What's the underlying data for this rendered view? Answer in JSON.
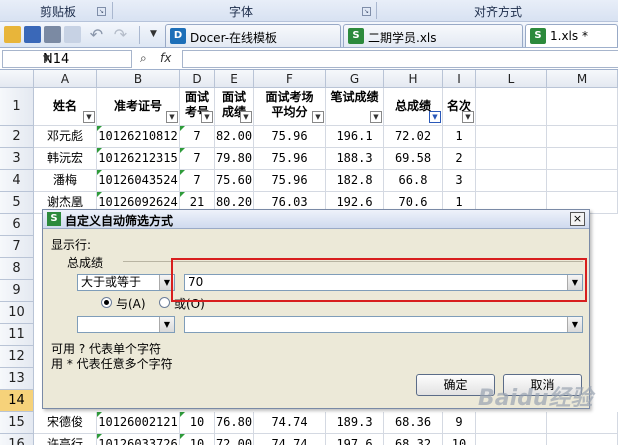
{
  "ribbon": {
    "groups": [
      "剪贴板",
      "字体",
      "对齐方式"
    ]
  },
  "tabs": [
    {
      "label": "Docer-在线模板",
      "icon": "D",
      "color": "#1d6fb8",
      "active": false
    },
    {
      "label": "二期学员.xls",
      "icon": "S",
      "color": "#2c8a3c",
      "active": false
    },
    {
      "label": "1.xls *",
      "icon": "S",
      "color": "#2c8a3c",
      "active": true
    }
  ],
  "formula_bar": {
    "name_box": "N14",
    "fx_symbol": "fx",
    "value": ""
  },
  "columns": [
    "A",
    "B",
    "D",
    "E",
    "F",
    "G",
    "H",
    "I",
    "L",
    "M"
  ],
  "row_numbers": [
    "1",
    "2",
    "3",
    "4",
    "5",
    "6",
    "7",
    "8",
    "9",
    "10",
    "11",
    "12",
    "13",
    "14",
    "15",
    "16"
  ],
  "selected_row": "14",
  "headers": [
    "姓名",
    "准考证号",
    "面试考号",
    "面试成绩",
    "面试考场平均分",
    "笔试成绩",
    "总成绩",
    "名次"
  ],
  "rows": [
    [
      "邓元彪",
      "10126210812",
      "7",
      "82.00",
      "75.96",
      "196.1",
      "72.02",
      "1"
    ],
    [
      "韩沅宏",
      "10126212315",
      "7",
      "79.80",
      "75.96",
      "188.3",
      "69.58",
      "2"
    ],
    [
      "潘梅",
      "10126043524",
      "7",
      "75.60",
      "75.96",
      "182.8",
      "66.8",
      "3"
    ],
    [
      "谢杰凰",
      "10126092624",
      "21",
      "80.20",
      "76.03",
      "192.6",
      "70.6",
      "1"
    ]
  ],
  "partial_rows": [
    [
      "宋德俊",
      "10126002121",
      "10",
      "76.80",
      "74.74",
      "189.3",
      "68.36",
      "9"
    ],
    [
      "许高行",
      "10126033726",
      "10",
      "72.00",
      "74.74",
      "197.6",
      "68.32",
      "10"
    ]
  ],
  "dialog": {
    "title": "自定义自动筛选方式",
    "show_rows_label": "显示行:",
    "field_label": "总成绩",
    "operator1": "大于或等于",
    "value1": "70",
    "and_label": "与(A)",
    "or_label": "或(O)",
    "operator2": "",
    "value2": "",
    "hint1": "可用 ? 代表单个字符",
    "hint2": "用 * 代表任意多个字符",
    "ok_label": "确定",
    "cancel_label": "取消",
    "logic": "and"
  },
  "watermark": "Baidu经验"
}
